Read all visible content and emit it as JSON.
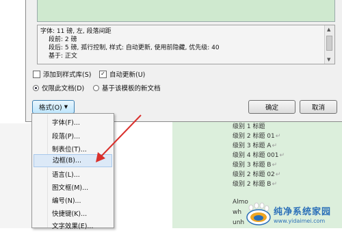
{
  "description": {
    "lines": [
      "字体: 11 磅, 左, 段落间距",
      "段前: 2 磅",
      "段后: 5 磅, 孤行控制, 样式: 自动更新, 使用前隐藏, 优先级: 40",
      "基于: 正文"
    ]
  },
  "options": {
    "add_to_gallery": "添加到样式库(S)",
    "auto_update": "自动更新(U)",
    "only_this_doc": "仅限此文档(D)",
    "new_docs_template": "基于该模板的新文档"
  },
  "buttons": {
    "format": "格式(O)",
    "ok": "确定",
    "cancel": "取消"
  },
  "menu": {
    "items": [
      "字体(F)...",
      "段落(P)...",
      "制表位(T)...",
      "边框(B)...",
      "语言(L)...",
      "图文框(M)...",
      "编号(N)...",
      "快捷键(K)...",
      "文字效果(E)..."
    ],
    "highlighted_index": 3
  },
  "document": {
    "lines": [
      "级别 1 标题",
      "级别 2 标题 01",
      "级别 3 标题 A",
      "级别 4 标题 001",
      "级别 3 标题 B",
      "级别 2 标题 02",
      "级别 2 标题 B"
    ],
    "body_fragments": [
      "Almo",
      "wh",
      "unh"
    ]
  },
  "watermark": {
    "title": "纯净系统家园",
    "url": "www.yidaimei.com"
  },
  "colors": {
    "annotation_arrow": "#d9302c",
    "document_page": "#dcefdc",
    "menu_highlight": "#dce9f7"
  }
}
